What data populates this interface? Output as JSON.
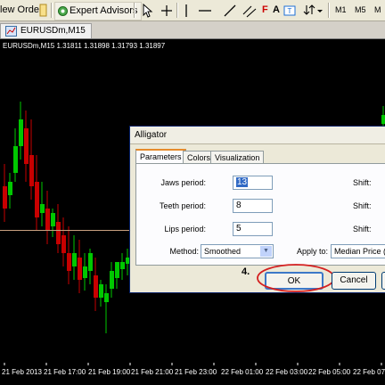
{
  "toolbar": {
    "new_order_label": "lew Order",
    "expert_advisors_label": "Expert Advisors",
    "timeframes": [
      "M1",
      "M5"
    ]
  },
  "tab": {
    "label": "EURUSDm,M15"
  },
  "chart": {
    "title": "EURUSDm,M15  1.31811 1.31898 1.31793 1.31897",
    "time_labels": [
      "21 Feb 2013",
      "21 Feb 17:00",
      "21 Feb 19:00",
      "21 Feb 21:00",
      "21 Feb 23:00",
      "22 Feb 01:00",
      "22 Feb 03:00",
      "22 Feb 05:00",
      "22 Feb 07:"
    ],
    "colors": {
      "bull": "#00c800",
      "bear": "#c80000",
      "background": "#000000"
    }
  },
  "dialog": {
    "title": "Alligator",
    "tabs": [
      "Parameters",
      "Colors",
      "Visualization"
    ],
    "jaws_label": "Jaws period:",
    "jaws_value": "13",
    "teeth_label": "Teeth period:",
    "teeth_value": "8",
    "lips_label": "Lips period:",
    "lips_value": "5",
    "shift_label": "Shift:",
    "method_label": "Method:",
    "method_value": "Smoothed",
    "apply_label": "Apply to:",
    "apply_value": "Median Price (H",
    "ok_label": "OK",
    "cancel_label": "Cancel",
    "step_annotation": "4."
  }
}
